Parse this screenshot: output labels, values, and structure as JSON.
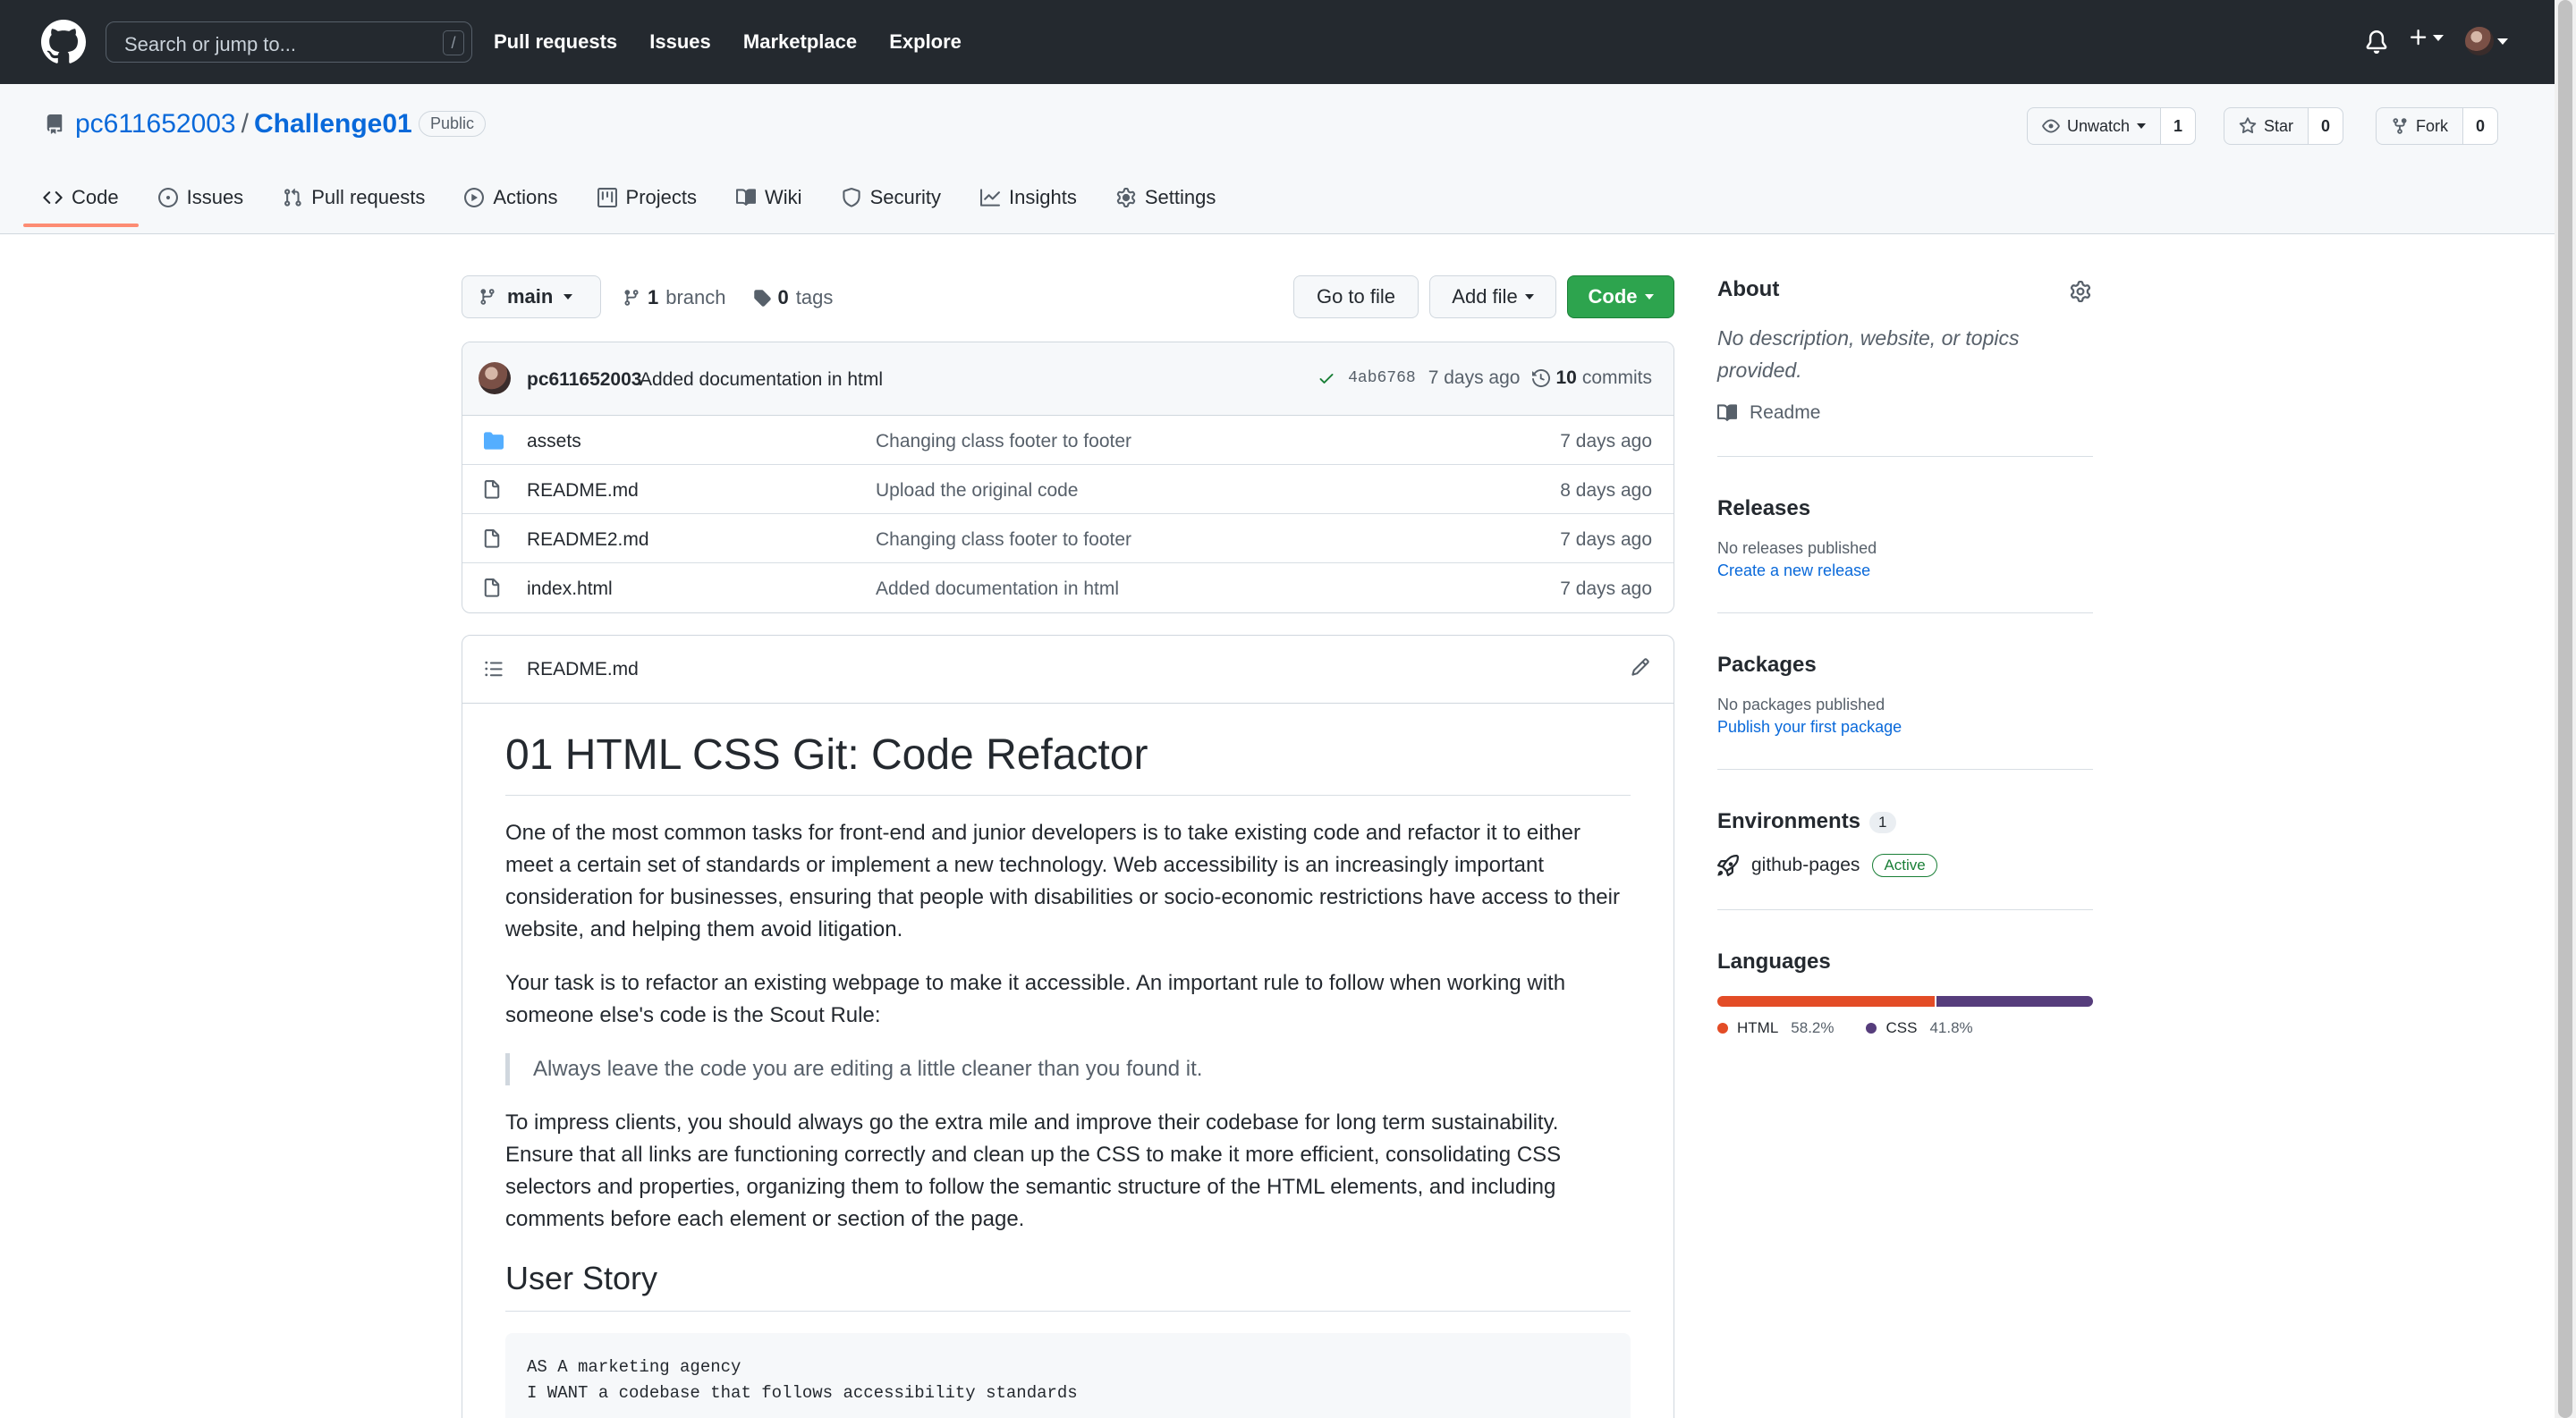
{
  "header": {
    "search_placeholder": "Search or jump to...",
    "search_key": "/",
    "nav": [
      "Pull requests",
      "Issues",
      "Marketplace",
      "Explore"
    ]
  },
  "repo": {
    "owner": "pc611652003",
    "separator": "/",
    "name": "Challenge01",
    "visibility": "Public",
    "watch_label": "Unwatch",
    "watch_count": "1",
    "star_label": "Star",
    "star_count": "0",
    "fork_label": "Fork",
    "fork_count": "0"
  },
  "tabs": [
    {
      "label": "Code",
      "icon": "code-icon",
      "active": true
    },
    {
      "label": "Issues",
      "icon": "issue-icon"
    },
    {
      "label": "Pull requests",
      "icon": "pull-request-icon"
    },
    {
      "label": "Actions",
      "icon": "play-icon"
    },
    {
      "label": "Projects",
      "icon": "project-icon"
    },
    {
      "label": "Wiki",
      "icon": "book-icon"
    },
    {
      "label": "Security",
      "icon": "shield-icon"
    },
    {
      "label": "Insights",
      "icon": "graph-icon"
    },
    {
      "label": "Settings",
      "icon": "gear-icon"
    }
  ],
  "toolbar": {
    "branch": "main",
    "branch_count": "1",
    "branch_word": "branch",
    "tag_count": "0",
    "tag_word": "tags",
    "go_to_file": "Go to file",
    "add_file": "Add file",
    "code": "Code"
  },
  "latest_commit": {
    "author": "pc611652003",
    "message": "Added documentation in html",
    "sha": "4ab6768",
    "age": "7 days ago",
    "commit_count": "10",
    "commit_word": "commits"
  },
  "files": [
    {
      "name": "assets",
      "type": "folder",
      "message": "Changing class footer to footer",
      "age": "7 days ago"
    },
    {
      "name": "README.md",
      "type": "file",
      "message": "Upload the original code",
      "age": "8 days ago"
    },
    {
      "name": "README2.md",
      "type": "file",
      "message": "Changing class footer to footer",
      "age": "7 days ago"
    },
    {
      "name": "index.html",
      "type": "file",
      "message": "Added documentation in html",
      "age": "7 days ago"
    }
  ],
  "readme": {
    "filename": "README.md",
    "h1": "01 HTML CSS Git: Code Refactor",
    "p1": "One of the most common tasks for front-end and junior developers is to take existing code and refactor it to either meet a certain set of standards or implement a new technology. Web accessibility is an increasingly important consideration for businesses, ensuring that people with disabilities or socio-economic restrictions have access to their website, and helping them avoid litigation.",
    "p2": "Your task is to refactor an existing webpage to make it accessible. An important rule to follow when working with someone else's code is the Scout Rule:",
    "quote": "Always leave the code you are editing a little cleaner than you found it.",
    "p3": "To impress clients, you should always go the extra mile and improve their codebase for long term sustainability. Ensure that all links are functioning correctly and clean up the CSS to make it more efficient, consolidating CSS selectors and properties, organizing them to follow the semantic structure of the HTML elements, and including comments before each element or section of the page.",
    "h2": "User Story",
    "code_line1": "AS A marketing agency",
    "code_line2": "I WANT a codebase that follows accessibility standards"
  },
  "sidebar": {
    "about_title": "About",
    "about_desc": "No description, website, or topics provided.",
    "readme_link": "Readme",
    "releases_title": "Releases",
    "releases_none": "No releases published",
    "releases_link": "Create a new release",
    "packages_title": "Packages",
    "packages_none": "No packages published",
    "packages_link": "Publish your first package",
    "env_title": "Environments",
    "env_count": "1",
    "env_name": "github-pages",
    "env_status": "Active",
    "languages_title": "Languages",
    "languages": [
      {
        "name": "HTML",
        "percent": "58.2%",
        "value": 58.2,
        "color": "#e34c26"
      },
      {
        "name": "CSS",
        "percent": "41.8%",
        "value": 41.8,
        "color": "#563d7c"
      }
    ]
  }
}
